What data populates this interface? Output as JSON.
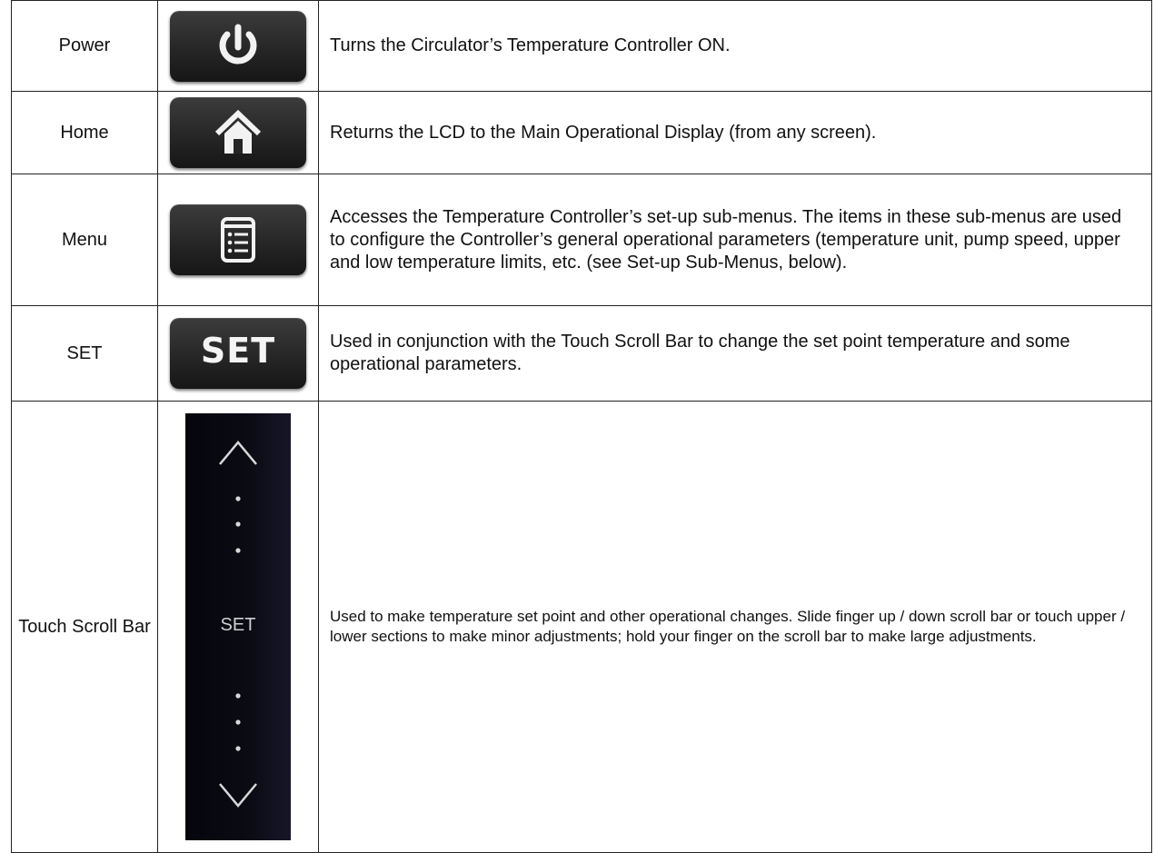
{
  "rows": [
    {
      "name": "Power",
      "icon": "power-icon",
      "description": "Turns the Circulator’s Temperature Controller ON."
    },
    {
      "name": "Home",
      "icon": "home-icon",
      "description": "Returns the LCD to the Main Operational Display (from any screen)."
    },
    {
      "name": "Menu",
      "icon": "menu-list-icon",
      "description": "Accesses the Temperature Controller’s set-up sub-menus. The items in these sub-menus are used to configure the Controller’s general operational parameters (temperature unit, pump speed, upper and low temperature limits, etc. (see Set-up Sub-Menus, below)."
    },
    {
      "name": "SET",
      "icon": "set-key",
      "key_label": "SET",
      "description": "Used in conjunction with the Touch Scroll Bar to change the set point temperature and some operational parameters."
    },
    {
      "name": "Touch Scroll Bar",
      "icon": "touch-scroll-bar",
      "bar_label": "SET",
      "description": "Used to make temperature set point and other operational changes. Slide finger up / down scroll bar or touch upper / lower sections to make minor adjustments; hold your finger on the scroll bar to make large adjustments."
    }
  ],
  "colors": {
    "key_body": "#262626",
    "key_symbol": "#f2f2f2",
    "scroll_bar_body": "#0b0b14",
    "table_border": "#222222"
  }
}
